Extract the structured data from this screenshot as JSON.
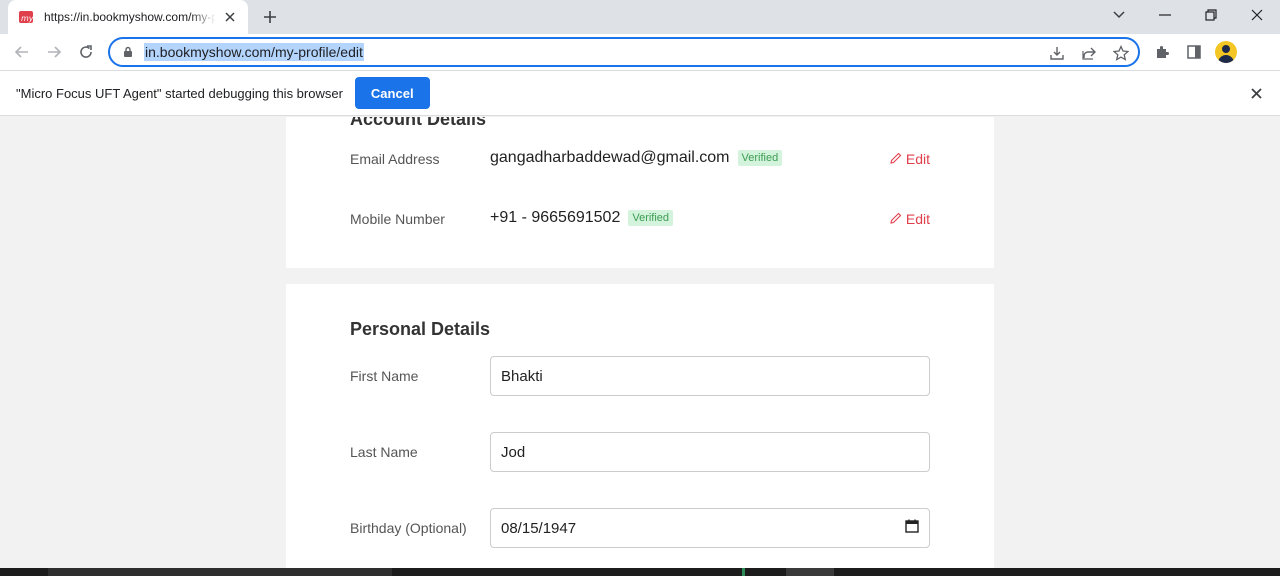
{
  "browser": {
    "tab_title": "https://in.bookmyshow.com/my-profile/edit",
    "url": "in.bookmyshow.com/my-profile/edit"
  },
  "infobar": {
    "message": "\"Micro Focus UFT Agent\" started debugging this browser",
    "cancel_label": "Cancel"
  },
  "account": {
    "title": "Account Details",
    "email_label": "Email Address",
    "email_value": "gangadharbaddewad@gmail.com",
    "mobile_label": "Mobile Number",
    "mobile_value": "+91 - 9665691502",
    "verified_label": "Verified",
    "edit_label": "Edit"
  },
  "personal": {
    "title": "Personal Details",
    "first_name_label": "First Name",
    "first_name_value": "Bhakti",
    "last_name_label": "Last Name",
    "last_name_value": "Jod",
    "birthday_label": "Birthday (Optional)",
    "birthday_value": "08/15/1947"
  },
  "colors": {
    "accent": "#1a73e8",
    "brand": "#e0404c",
    "verified_bg": "#d4f3dc",
    "verified_text": "#3c9d52"
  }
}
